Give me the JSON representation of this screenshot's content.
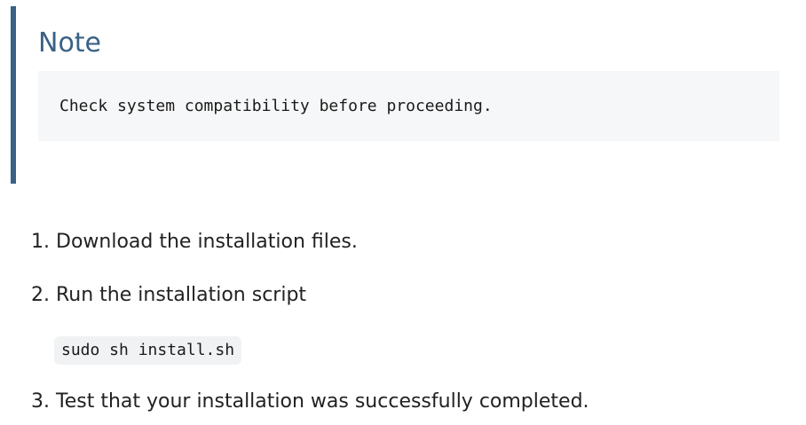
{
  "note": {
    "title": "Note",
    "code": "Check system compatibility before proceeding."
  },
  "steps": [
    {
      "number": "1.",
      "text": "Download the installation files."
    },
    {
      "number": "2.",
      "text": "Run the installation script"
    },
    {
      "number": "3.",
      "text": "Test that your installation was successfully completed."
    }
  ],
  "command": "sudo sh install.sh",
  "colors": {
    "accent": "#3a6186",
    "code_background": "#f6f7f8",
    "inline_code_background": "#f1f2f3",
    "text": "#222222"
  }
}
